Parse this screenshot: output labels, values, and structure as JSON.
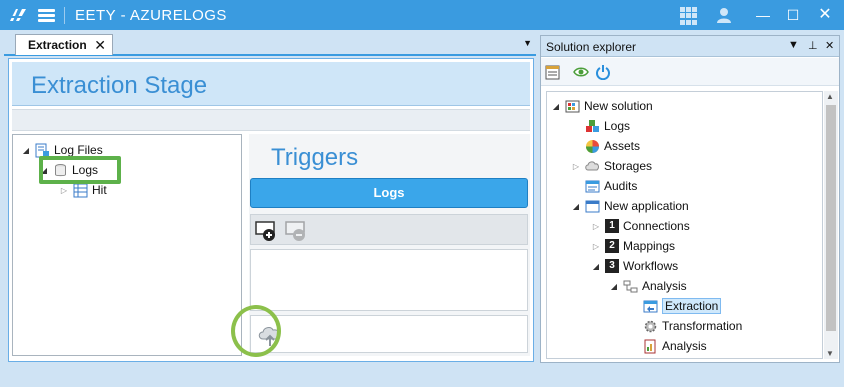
{
  "app": {
    "title": "EETY - AZURELOGS"
  },
  "titlebar": {
    "icons": [
      "app-logo-icon",
      "hamburger-menu-icon",
      "grid-apps-icon",
      "user-icon"
    ],
    "window_controls": {
      "minimize": "—",
      "maximize": "☐",
      "close": "✕"
    }
  },
  "document": {
    "tab_label": "Extraction",
    "tab_close": "✕",
    "tab_menu": "▼",
    "stage_title": "Extraction Stage",
    "tree": [
      {
        "label": "Log Files",
        "expander": "◢"
      },
      {
        "label": "Logs",
        "expander": "◢"
      },
      {
        "label": "Hit",
        "expander": "▷"
      }
    ],
    "triggers": {
      "title": "Triggers",
      "selected_source": "Logs"
    }
  },
  "solution": {
    "title": "Solution explorer",
    "head_buttons": [
      "▼",
      "⊥",
      "✕"
    ],
    "tree": [
      {
        "label": "New solution",
        "expander": "◢"
      },
      {
        "label": "Logs",
        "expander": ""
      },
      {
        "label": "Assets",
        "expander": ""
      },
      {
        "label": "Storages",
        "expander": "▷"
      },
      {
        "label": "Audits",
        "expander": ""
      },
      {
        "label": "New application",
        "expander": "◢"
      },
      {
        "label": "Connections",
        "expander": "▷",
        "badge": "1"
      },
      {
        "label": "Mappings",
        "expander": "▷",
        "badge": "2"
      },
      {
        "label": "Workflows",
        "expander": "◢",
        "badge": "3"
      },
      {
        "label": "Analysis",
        "expander": "◢"
      },
      {
        "label": "Extraction",
        "expander": ""
      },
      {
        "label": "Transformation",
        "expander": ""
      },
      {
        "label": "Analysis",
        "expander": ""
      }
    ],
    "scroll": {
      "up": "▲",
      "down": "▼"
    }
  },
  "colors": {
    "accent": "#3a9be0",
    "highlight_green": "#5db14a",
    "logs_bar": "#3aa6ea"
  }
}
